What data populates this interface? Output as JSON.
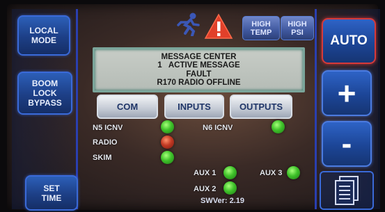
{
  "left_panel": {
    "local_mode": [
      "LOCAL",
      "MODE"
    ],
    "boom_lock_bypass": [
      "BOOM",
      "LOCK",
      "BYPASS"
    ],
    "set_time": [
      "SET",
      "TIME"
    ]
  },
  "top_indicators": {
    "high_temp": [
      "HIGH",
      "TEMP"
    ],
    "high_psi": [
      "HIGH",
      "PSI"
    ]
  },
  "message_center": {
    "title": "MESSAGE CENTER",
    "count_line": "1   ACTIVE MESSAGE",
    "type": "FAULT",
    "message": "R170 RADIO OFFLINE"
  },
  "tabs": [
    "COM",
    "INPUTS",
    "OUTPUTS"
  ],
  "status": {
    "n5": {
      "label": "N5 ICNV",
      "state": "green"
    },
    "n6": {
      "label": "N6 ICNV",
      "state": "green"
    },
    "radio": {
      "label": "RADIO",
      "state": "red"
    },
    "skim": {
      "label": "SKIM",
      "state": "green"
    },
    "aux1": {
      "label": "AUX 1",
      "state": "green"
    },
    "aux2": {
      "label": "AUX 2",
      "state": "green"
    },
    "aux3": {
      "label": "AUX 3",
      "state": "green"
    }
  },
  "right_panel": {
    "auto": "AUTO",
    "plus": "+",
    "minus": "-"
  },
  "software_version": "SWVer: 2.19",
  "colors": {
    "accent_blue": "#2a3fb0",
    "warning_red": "#e0402a",
    "led_green": "#3fc22a",
    "led_red": "#c23a24"
  },
  "icons": [
    "running-person-icon",
    "warning-triangle-icon",
    "documents-icon"
  ]
}
